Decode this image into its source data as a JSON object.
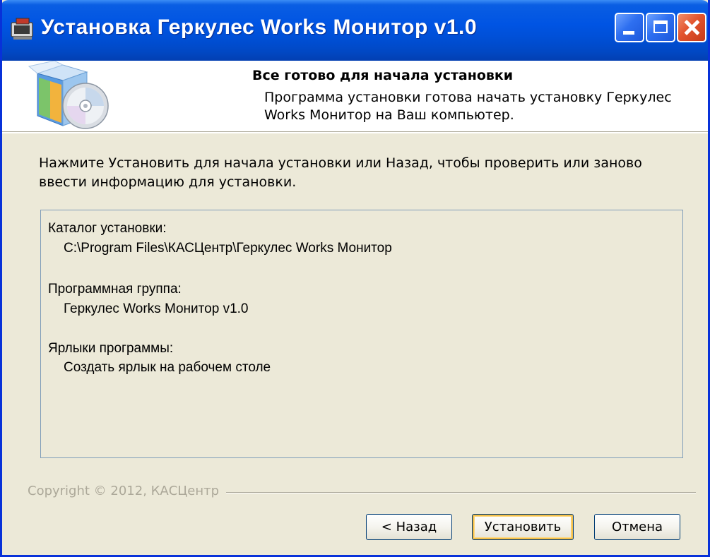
{
  "window": {
    "title": "Установка Геркулес Works Монитор v1.0"
  },
  "header": {
    "title": "Все готово для начала установки",
    "subtitle": "Программа установки готова начать установку Геркулес Works Монитор на Ваш компьютер.",
    "icon": "installer-box-disc-icon"
  },
  "body": {
    "instruction": "Нажмите Установить для начала установки или Назад, чтобы проверить или заново ввести информацию для установки.",
    "summary": [
      {
        "label": "Каталог установки:",
        "value": "C:\\Program Files\\КАСЦентр\\Геркулес Works Монитор"
      },
      {
        "label": "Программная группа:",
        "value": "Геркулес Works Монитор v1.0"
      },
      {
        "label": "Ярлыки программы:",
        "value": "Создать ярлык на рабочем столе"
      }
    ]
  },
  "footer": {
    "copyright": "Copyright © 2012, КАСЦентр",
    "back_label": "< Назад",
    "install_label": "Установить",
    "cancel_label": "Отмена"
  },
  "colors": {
    "titlebar": "#0054e3",
    "window_bg": "#ece9d8",
    "close_button": "#e2542e",
    "default_button_focus": "#f4c04a"
  }
}
